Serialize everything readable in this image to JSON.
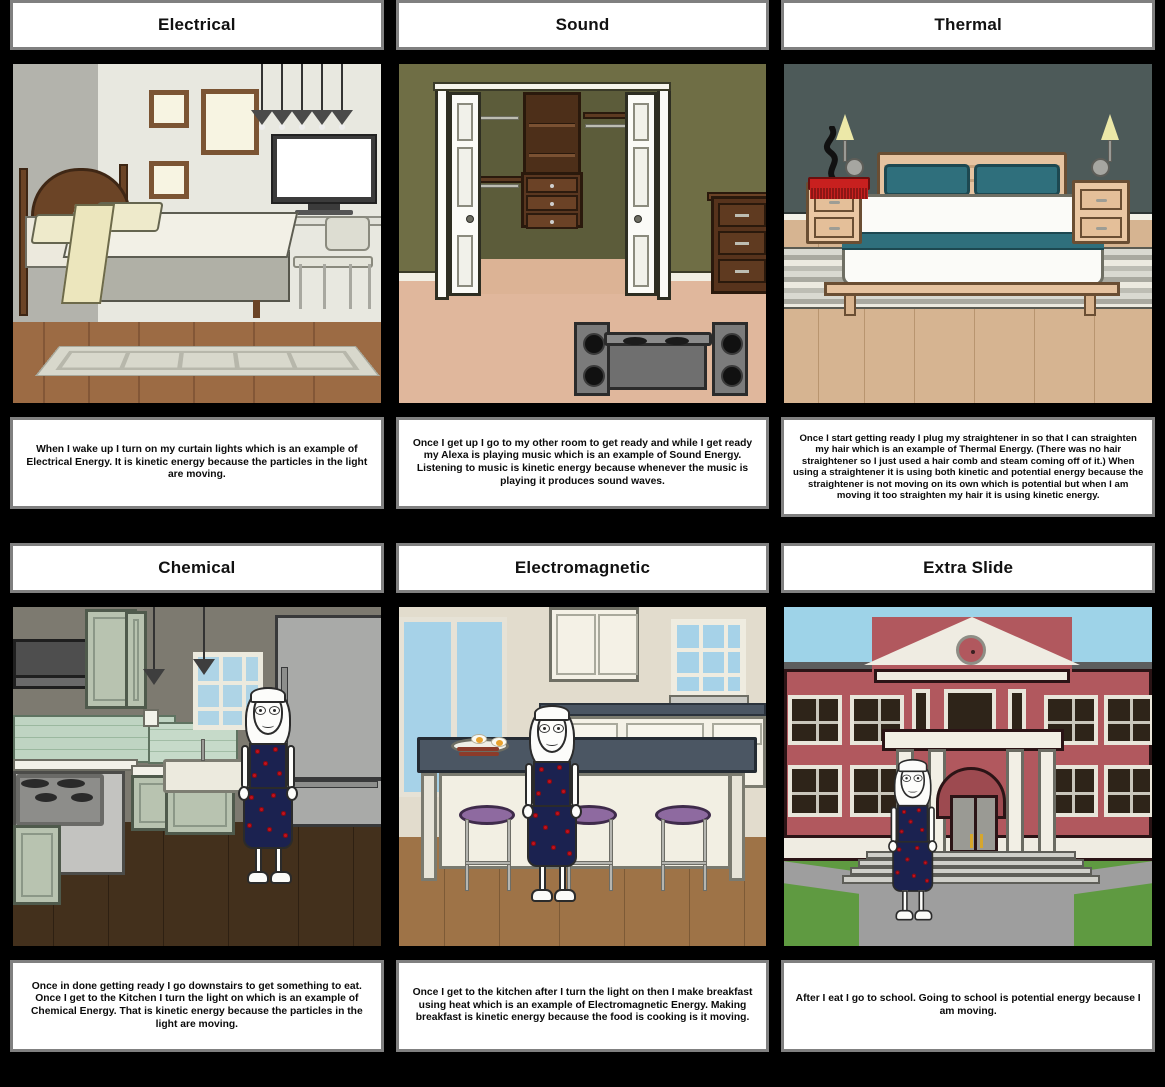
{
  "storyboard": {
    "background_color": "#000000",
    "panel_border_color": "#808080",
    "cells": [
      {
        "id": "electrical",
        "title": "Electrical",
        "caption": "When I wake up I turn on my curtain lights which is an example of Electrical Energy. It is kinetic energy because the particles in the light are moving.",
        "scene": "bedroom-with-pendant-lights-tv-desk"
      },
      {
        "id": "sound",
        "title": "Sound",
        "caption": "Once I get up I go to my other room to get ready and while I get ready my Alexa is playing music which is an example of Sound Energy. Listening to music is kinetic energy because whenever the music is playing it produces sound waves.",
        "scene": "closet-with-speakers-and-dresser"
      },
      {
        "id": "thermal",
        "title": "Thermal",
        "caption": "Once I start getting ready I plug my straightener in so that I can straighten my hair which is an example of Thermal Energy. (There was no hair straightener so I just used a hair comb and steam coming off of it.) When using a straightener it is using both kinetic and potential energy because the straightener is not moving on its own which is potential but when I am moving it too straighten my hair it is using kinetic energy.",
        "scene": "modern-bedroom-with-hair-comb-and-steam"
      },
      {
        "id": "chemical",
        "title": "Chemical",
        "caption": "Once in done getting ready I go downstairs to get something to eat. Once I get to the Kitchen I turn the light on which is an example of Chemical Energy. That is kinetic energy because the particles in the light are moving.",
        "scene": "kitchen-with-stove-fridge-and-character"
      },
      {
        "id": "electromagnetic",
        "title": "Electromagnetic",
        "caption": "Once I get to the kitchen after I turn the light on then I make breakfast using heat which is an example of Electromagnetic Energy. Making breakfast is kinetic energy because the food is cooking is it moving.",
        "scene": "kitchen-island-with-breakfast-plate-and-stools"
      },
      {
        "id": "extra",
        "title": "Extra Slide",
        "caption": "After I eat I go to school. Going to school is potential energy because I am moving.",
        "scene": "school-building-exterior-with-character"
      }
    ]
  },
  "palette": {
    "bedroom_wall": "#e8e8e0",
    "bedroom_floor": "#9c6b44",
    "closet_wall": "#6f6e45",
    "closet_floor": "#e0b79c",
    "thermal_wall": "#4d5a59",
    "thermal_accent": "#2f6f7c",
    "thermal_floor": "#d6b491",
    "kitchen_wall": "#7d7a70",
    "kitchen_floor": "#43301c",
    "kitchen_backsplash": "#bfd4c2",
    "island_counter": "#4b5663",
    "stool_seat": "#8e6aa0",
    "school_brick": "#b1585e",
    "school_sky": "#9ed3e8",
    "school_grass": "#5f9a41",
    "dress_navy": "#1b2250",
    "dress_rose": "#c1121f",
    "comb_red": "#c8201f"
  }
}
